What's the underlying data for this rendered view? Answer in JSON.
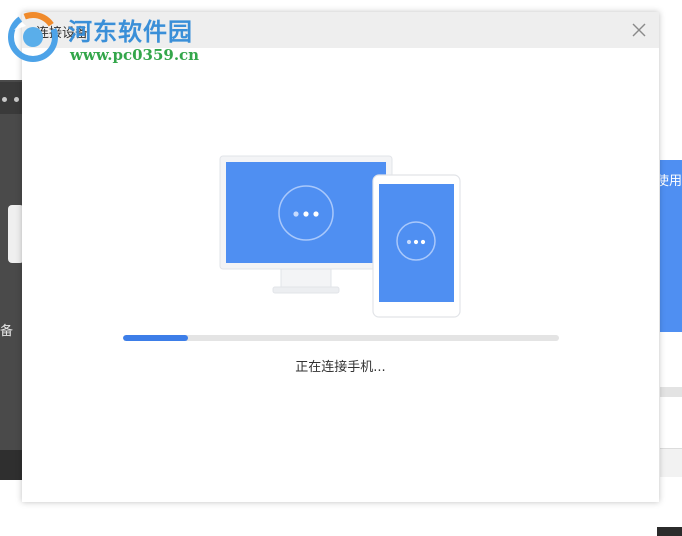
{
  "watermark": {
    "site_name": "河东软件园",
    "url": "www.pc0359.cn"
  },
  "dialog": {
    "title": "连接设备",
    "close_icon": "close-icon",
    "status": "正在连接手机...",
    "progress": 0.15
  },
  "background": {
    "left_text": "备",
    "right_text": "使用"
  },
  "colors": {
    "accent": "#3d7ee8",
    "screen_blue": "#4f8ff2",
    "watermark_blue": "#3a8fd8",
    "watermark_green": "#33a64a"
  }
}
